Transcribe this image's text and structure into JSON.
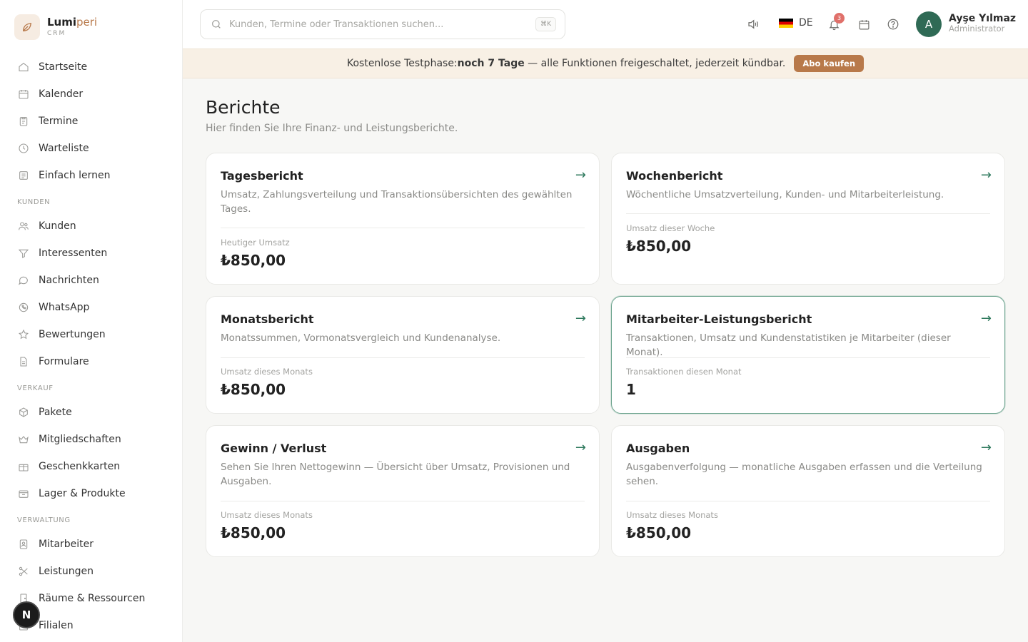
{
  "brand": {
    "name_main": "Lumi",
    "name_accent": "peri",
    "sub": "CRM"
  },
  "sidebar": {
    "main": [
      {
        "label": "Startseite",
        "icon": "home-icon"
      },
      {
        "label": "Kalender",
        "icon": "calendar-icon"
      },
      {
        "label": "Termine",
        "icon": "clipboard-icon"
      },
      {
        "label": "Warteliste",
        "icon": "clock-icon"
      },
      {
        "label": "Einfach lernen",
        "icon": "book-icon"
      }
    ],
    "section_kunden": "KUNDEN",
    "kunden": [
      {
        "label": "Kunden",
        "icon": "users-icon"
      },
      {
        "label": "Interessenten",
        "icon": "filter-icon"
      },
      {
        "label": "Nachrichten",
        "icon": "chat-icon"
      },
      {
        "label": "WhatsApp",
        "icon": "whatsapp-icon"
      },
      {
        "label": "Bewertungen",
        "icon": "star-icon"
      },
      {
        "label": "Formulare",
        "icon": "document-icon"
      }
    ],
    "section_verkauf": "VERKAUF",
    "verkauf": [
      {
        "label": "Pakete",
        "icon": "package-icon"
      },
      {
        "label": "Mitgliedschaften",
        "icon": "crown-icon"
      },
      {
        "label": "Geschenkkarten",
        "icon": "gift-icon"
      },
      {
        "label": "Lager & Produkte",
        "icon": "box-icon"
      }
    ],
    "section_verwaltung": "VERWALTUNG",
    "verwaltung": [
      {
        "label": "Mitarbeiter",
        "icon": "id-badge-icon"
      },
      {
        "label": "Leistungen",
        "icon": "scissors-icon"
      },
      {
        "label": "Räume & Ressourcen",
        "icon": "door-icon"
      },
      {
        "label": "Filialen",
        "icon": "building-icon"
      }
    ],
    "floating_badge": "N"
  },
  "topbar": {
    "search_placeholder": "Kunden, Termine oder Transaktionen suchen...",
    "search_shortcut": "⌘K",
    "language": "DE",
    "notification_count": "3",
    "user": {
      "initial": "A",
      "name": "Ayşe Yılmaz",
      "role": "Administrator"
    }
  },
  "banner": {
    "prefix": "Kostenlose Testphase: ",
    "highlight": "noch 7 Tage",
    "suffix": " — alle Funktionen freigeschaltet, jederzeit kündbar.",
    "button": "Abo kaufen"
  },
  "page": {
    "title": "Berichte",
    "subtitle": "Hier finden Sie Ihre Finanz- und Leistungsberichte."
  },
  "cards": [
    {
      "title": "Tagesbericht",
      "desc": "Umsatz, Zahlungsverteilung und Transaktionsübersichten des gewählten Tages.",
      "label": "Heutiger Umsatz",
      "value": "₺850,00"
    },
    {
      "title": "Wochenbericht",
      "desc": "Wöchentliche Umsatzverteilung, Kunden- und Mitarbeiterleistung.",
      "label": "Umsatz dieser Woche",
      "value": "₺850,00"
    },
    {
      "title": "Monatsbericht",
      "desc": "Monatssummen, Vormonatsvergleich und Kundenanalyse.",
      "label": "Umsatz dieses Monats",
      "value": "₺850,00"
    },
    {
      "title": "Mitarbeiter-Leistungsbericht",
      "desc": "Transaktionen, Umsatz und Kundenstatistiken je Mitarbeiter (dieser Monat).",
      "label": "Transaktionen diesen Monat",
      "value": "1"
    },
    {
      "title": "Gewinn / Verlust",
      "desc": "Sehen Sie Ihren Nettogewinn — Übersicht über Umsatz, Provisionen und Ausgaben.",
      "label": "Umsatz dieses Monats",
      "value": "₺850,00"
    },
    {
      "title": "Ausgaben",
      "desc": "Ausgabenverfolgung — monatliche Ausgaben erfassen und die Verteilung sehen.",
      "label": "Umsatz dieses Monats",
      "value": "₺850,00"
    }
  ],
  "card_arrow": "→",
  "colors": {
    "accent": "#b8794a",
    "green": "#2f6a55",
    "banner_bg": "#f8f0e5"
  }
}
